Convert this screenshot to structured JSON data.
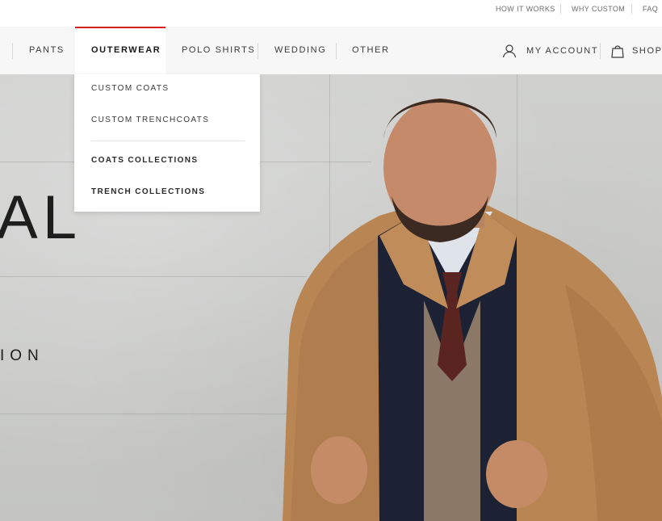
{
  "utility": {
    "how_it_works": "HOW IT WORKS",
    "why_custom": "WHY CUSTOM",
    "faq": "FAQ"
  },
  "nav": {
    "items": [
      {
        "label": "PANTS"
      },
      {
        "label": "OUTERWEAR"
      },
      {
        "label": "POLO SHIRTS"
      },
      {
        "label": "WEDDING"
      },
      {
        "label": "OTHER"
      }
    ],
    "my_account": "MY ACCOUNT",
    "shopping": "SHOPP"
  },
  "dropdown": {
    "items": [
      {
        "label": "CUSTOM COATS"
      },
      {
        "label": "CUSTOM TRENCHCOATS"
      },
      {
        "label": "COATS COLLECTIONS"
      },
      {
        "label": "TRENCH COLLECTIONS"
      }
    ]
  },
  "hero": {
    "title": "AL",
    "subtitle": "ION"
  },
  "colors": {
    "accent": "#d9201f",
    "nav_bg": "#f7f7f7",
    "coat": "#b98552"
  },
  "icons": {
    "account": "user-icon",
    "bag": "shopping-bag-icon"
  }
}
